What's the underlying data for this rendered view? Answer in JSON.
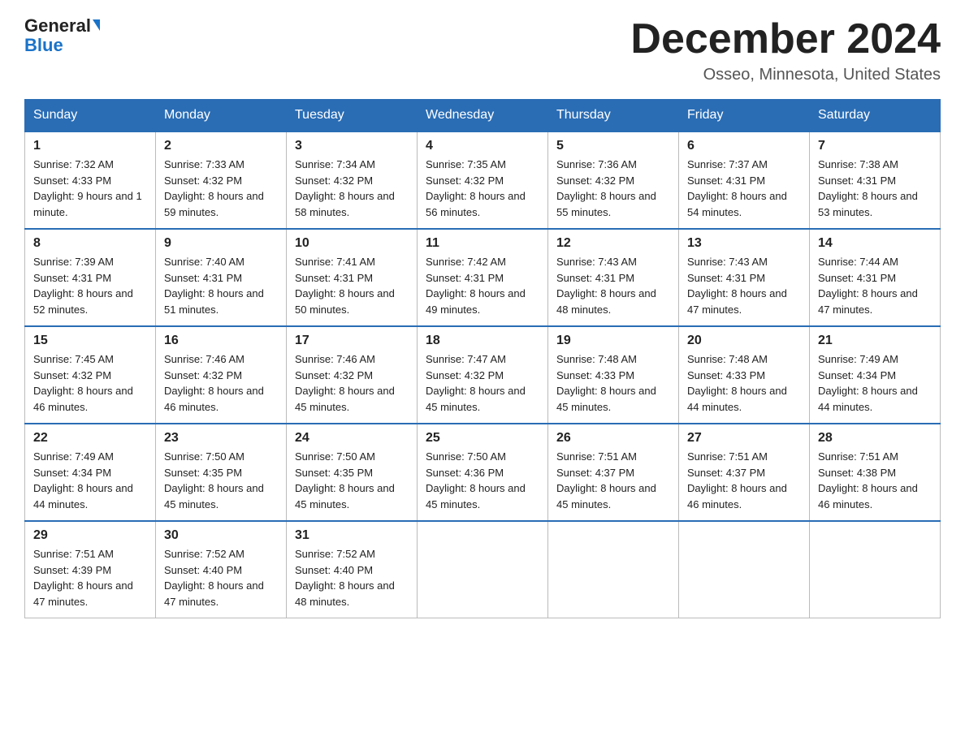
{
  "header": {
    "logo_general": "General",
    "logo_blue": "Blue",
    "month_title": "December 2024",
    "location": "Osseo, Minnesota, United States"
  },
  "days_of_week": [
    "Sunday",
    "Monday",
    "Tuesday",
    "Wednesday",
    "Thursday",
    "Friday",
    "Saturday"
  ],
  "weeks": [
    [
      {
        "day": "1",
        "sunrise": "7:32 AM",
        "sunset": "4:33 PM",
        "daylight": "9 hours and 1 minute."
      },
      {
        "day": "2",
        "sunrise": "7:33 AM",
        "sunset": "4:32 PM",
        "daylight": "8 hours and 59 minutes."
      },
      {
        "day": "3",
        "sunrise": "7:34 AM",
        "sunset": "4:32 PM",
        "daylight": "8 hours and 58 minutes."
      },
      {
        "day": "4",
        "sunrise": "7:35 AM",
        "sunset": "4:32 PM",
        "daylight": "8 hours and 56 minutes."
      },
      {
        "day": "5",
        "sunrise": "7:36 AM",
        "sunset": "4:32 PM",
        "daylight": "8 hours and 55 minutes."
      },
      {
        "day": "6",
        "sunrise": "7:37 AM",
        "sunset": "4:31 PM",
        "daylight": "8 hours and 54 minutes."
      },
      {
        "day": "7",
        "sunrise": "7:38 AM",
        "sunset": "4:31 PM",
        "daylight": "8 hours and 53 minutes."
      }
    ],
    [
      {
        "day": "8",
        "sunrise": "7:39 AM",
        "sunset": "4:31 PM",
        "daylight": "8 hours and 52 minutes."
      },
      {
        "day": "9",
        "sunrise": "7:40 AM",
        "sunset": "4:31 PM",
        "daylight": "8 hours and 51 minutes."
      },
      {
        "day": "10",
        "sunrise": "7:41 AM",
        "sunset": "4:31 PM",
        "daylight": "8 hours and 50 minutes."
      },
      {
        "day": "11",
        "sunrise": "7:42 AM",
        "sunset": "4:31 PM",
        "daylight": "8 hours and 49 minutes."
      },
      {
        "day": "12",
        "sunrise": "7:43 AM",
        "sunset": "4:31 PM",
        "daylight": "8 hours and 48 minutes."
      },
      {
        "day": "13",
        "sunrise": "7:43 AM",
        "sunset": "4:31 PM",
        "daylight": "8 hours and 47 minutes."
      },
      {
        "day": "14",
        "sunrise": "7:44 AM",
        "sunset": "4:31 PM",
        "daylight": "8 hours and 47 minutes."
      }
    ],
    [
      {
        "day": "15",
        "sunrise": "7:45 AM",
        "sunset": "4:32 PM",
        "daylight": "8 hours and 46 minutes."
      },
      {
        "day": "16",
        "sunrise": "7:46 AM",
        "sunset": "4:32 PM",
        "daylight": "8 hours and 46 minutes."
      },
      {
        "day": "17",
        "sunrise": "7:46 AM",
        "sunset": "4:32 PM",
        "daylight": "8 hours and 45 minutes."
      },
      {
        "day": "18",
        "sunrise": "7:47 AM",
        "sunset": "4:32 PM",
        "daylight": "8 hours and 45 minutes."
      },
      {
        "day": "19",
        "sunrise": "7:48 AM",
        "sunset": "4:33 PM",
        "daylight": "8 hours and 45 minutes."
      },
      {
        "day": "20",
        "sunrise": "7:48 AM",
        "sunset": "4:33 PM",
        "daylight": "8 hours and 44 minutes."
      },
      {
        "day": "21",
        "sunrise": "7:49 AM",
        "sunset": "4:34 PM",
        "daylight": "8 hours and 44 minutes."
      }
    ],
    [
      {
        "day": "22",
        "sunrise": "7:49 AM",
        "sunset": "4:34 PM",
        "daylight": "8 hours and 44 minutes."
      },
      {
        "day": "23",
        "sunrise": "7:50 AM",
        "sunset": "4:35 PM",
        "daylight": "8 hours and 45 minutes."
      },
      {
        "day": "24",
        "sunrise": "7:50 AM",
        "sunset": "4:35 PM",
        "daylight": "8 hours and 45 minutes."
      },
      {
        "day": "25",
        "sunrise": "7:50 AM",
        "sunset": "4:36 PM",
        "daylight": "8 hours and 45 minutes."
      },
      {
        "day": "26",
        "sunrise": "7:51 AM",
        "sunset": "4:37 PM",
        "daylight": "8 hours and 45 minutes."
      },
      {
        "day": "27",
        "sunrise": "7:51 AM",
        "sunset": "4:37 PM",
        "daylight": "8 hours and 46 minutes."
      },
      {
        "day": "28",
        "sunrise": "7:51 AM",
        "sunset": "4:38 PM",
        "daylight": "8 hours and 46 minutes."
      }
    ],
    [
      {
        "day": "29",
        "sunrise": "7:51 AM",
        "sunset": "4:39 PM",
        "daylight": "8 hours and 47 minutes."
      },
      {
        "day": "30",
        "sunrise": "7:52 AM",
        "sunset": "4:40 PM",
        "daylight": "8 hours and 47 minutes."
      },
      {
        "day": "31",
        "sunrise": "7:52 AM",
        "sunset": "4:40 PM",
        "daylight": "8 hours and 48 minutes."
      },
      null,
      null,
      null,
      null
    ]
  ]
}
